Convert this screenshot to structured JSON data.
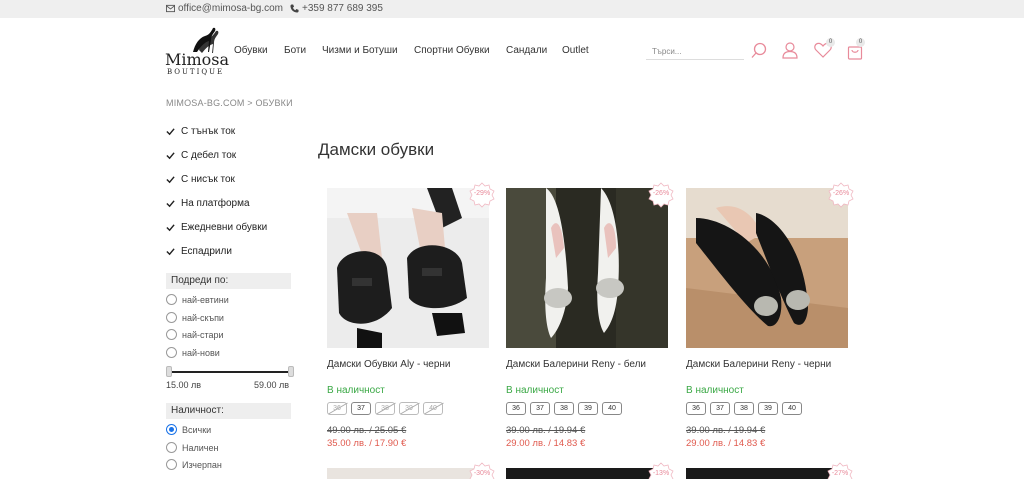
{
  "topbar": {
    "email": "office@mimosa-bg.com",
    "phone": "+359 877 689 395"
  },
  "logo": {
    "name": "Mimosa",
    "sub": "BOUTIQUE"
  },
  "nav": [
    "Обувки",
    "Боти",
    "Чизми и Ботуши",
    "Спортни Обувки",
    "Сандали",
    "Outlet"
  ],
  "search": {
    "placeholder": "Търси..."
  },
  "header_counts": {
    "wishlist": "0",
    "cart": "0"
  },
  "breadcrumb": "MIMOSA-BG.COM > ОБУВКИ",
  "categories": [
    "С тънък ток",
    "С дебел ток",
    "С нисък ток",
    "На платформа",
    "Ежедневни обувки",
    "Еспадрили"
  ],
  "sort": {
    "label": "Подреди по:",
    "options": [
      "най-евтини",
      "най-скъпи",
      "най-стари",
      "най-нови"
    ]
  },
  "price": {
    "min_label": "15.00 лв",
    "max_label": "59.00 лв"
  },
  "availability": {
    "label": "Наличност:",
    "options": [
      "Всички",
      "Наличен",
      "Изчерпан"
    ],
    "selected": "Всички"
  },
  "page_title": "Дамски обувки",
  "products": [
    {
      "name": "Дамски Обувки Aly - черни",
      "discount": "-29%",
      "stock": "В наличност",
      "sizes": [
        {
          "label": "36",
          "available": false
        },
        {
          "label": "37",
          "available": true
        },
        {
          "label": "38",
          "available": false
        },
        {
          "label": "39",
          "available": false
        },
        {
          "label": "40",
          "available": false
        }
      ],
      "old_price": "49.00 лв. / 25.05 €",
      "new_price": "35.00 лв. / 17.90 €"
    },
    {
      "name": "Дамски Балерини Reny - бели",
      "discount": "-26%",
      "stock": "В наличност",
      "sizes": [
        {
          "label": "36",
          "available": true
        },
        {
          "label": "37",
          "available": true
        },
        {
          "label": "38",
          "available": true
        },
        {
          "label": "39",
          "available": true
        },
        {
          "label": "40",
          "available": true
        }
      ],
      "old_price": "39.00 лв. / 19.94 €",
      "new_price": "29.00 лв. / 14.83 €"
    },
    {
      "name": "Дамски Балерини Reny - черни",
      "discount": "-26%",
      "stock": "В наличност",
      "sizes": [
        {
          "label": "36",
          "available": true
        },
        {
          "label": "37",
          "available": true
        },
        {
          "label": "38",
          "available": true
        },
        {
          "label": "39",
          "available": true
        },
        {
          "label": "40",
          "available": true
        }
      ],
      "old_price": "39.00 лв. / 19.94 €",
      "new_price": "29.00 лв. / 14.83 €"
    }
  ],
  "second_row_discounts": [
    "-30%",
    "-13%",
    "-27%"
  ],
  "colors": {
    "accent": "#e88a9a",
    "stock": "#3aa845",
    "sale": "#e05a4e"
  }
}
